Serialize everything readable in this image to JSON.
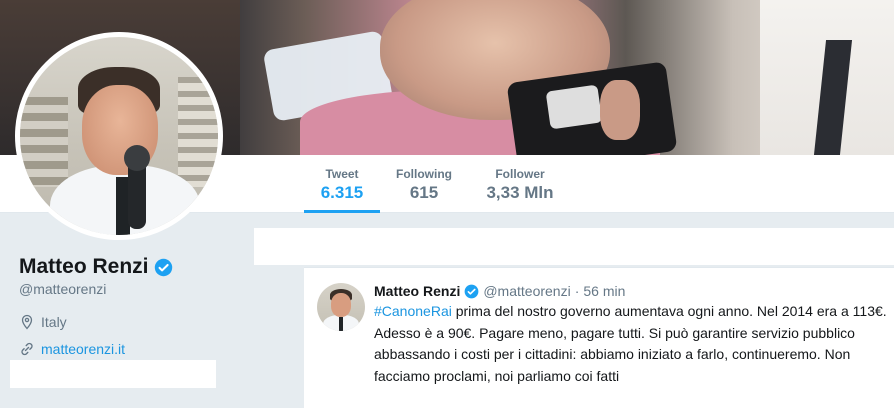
{
  "nav": {
    "stats": [
      {
        "label": "Tweet",
        "value": "6.315",
        "active": true
      },
      {
        "label": "Following",
        "value": "615",
        "active": false
      },
      {
        "label": "Follower",
        "value": "3,33 Mln",
        "active": false
      }
    ]
  },
  "profile": {
    "name": "Matteo Renzi",
    "handle": "@matteorenzi",
    "location": "Italy",
    "url": "matteorenzi.it",
    "verified": true
  },
  "tweet": {
    "author_name": "Matteo Renzi",
    "author_handle": "@matteorenzi",
    "separator": "·",
    "time": "56 min",
    "hashtag": "#CanoneRai",
    "text": " prima del nostro governo aumentava ogni anno. Nel 2014 era a 113€. Adesso è a 90€. Pagare meno, pagare tutti. Si può garantire servizio pubblico abbassando i costi per i cittadini: abbiamo iniziato a farlo, continueremo. Non facciamo proclami, noi parliamo coi fatti"
  },
  "colors": {
    "accent": "#1da1f2",
    "link": "#1b95e0",
    "muted": "#657786",
    "page_bg": "#e6ecf0"
  },
  "icons": {
    "verified": "verified-badge-icon",
    "location": "location-pin-icon",
    "link": "link-icon"
  }
}
